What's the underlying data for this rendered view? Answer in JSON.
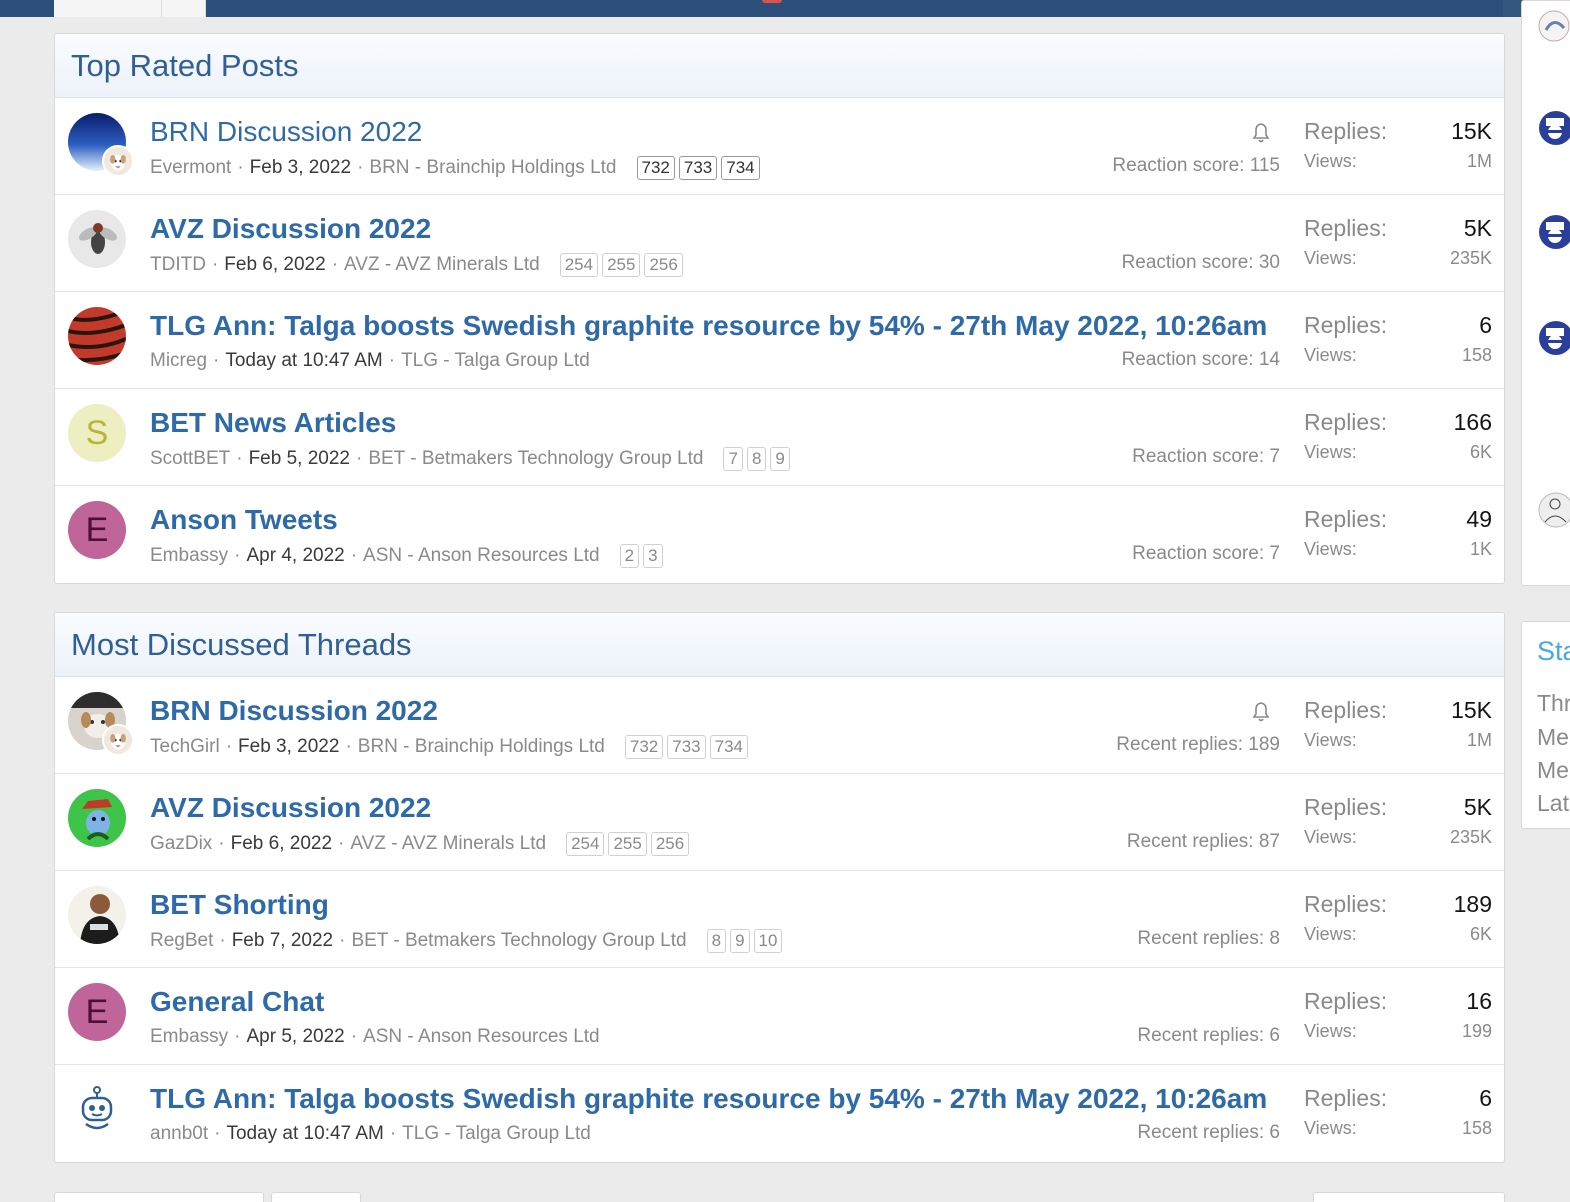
{
  "top_rated": {
    "title": "Top Rated Posts",
    "rows": [
      {
        "title": "BRN Discussion 2022",
        "bold": false,
        "author": "Evermont",
        "date": "Feb 3, 2022",
        "forum": "BRN - Brainchip Holdings Ltd",
        "pages": [
          "732",
          "733",
          "734"
        ],
        "pages_dark": true,
        "bell": true,
        "score": "Reaction score: 115",
        "replies_label": "Replies:",
        "replies": "15K",
        "views_label": "Views:",
        "views": "1M",
        "avatar": "blue-gradient-avatar",
        "avatar_letter": ""
      },
      {
        "title": "AVZ Discussion 2022",
        "bold": true,
        "author": "TDITD",
        "date": "Feb 6, 2022",
        "forum": "AVZ - AVZ Minerals Ltd",
        "pages": [
          "254",
          "255",
          "256"
        ],
        "pages_dark": false,
        "bell": false,
        "score": "Reaction score: 30",
        "replies_label": "Replies:",
        "replies": "5K",
        "views_label": "Views:",
        "views": "235K",
        "avatar": "fly-avatar",
        "avatar_letter": ""
      },
      {
        "title": "TLG Ann: Talga boosts Swedish graphite resource by 54% - 27th May 2022, 10:26am",
        "bold": true,
        "author": "Micreg",
        "date": "Today at 10:47 AM",
        "forum": "TLG - Talga Group Ltd",
        "pages": [],
        "pages_dark": false,
        "bell": false,
        "score": "Reaction score: 14",
        "replies_label": "Replies:",
        "replies": "6",
        "views_label": "Views:",
        "views": "158",
        "avatar": "tiger-stripe-avatar",
        "avatar_letter": ""
      },
      {
        "title": "BET News Articles",
        "bold": true,
        "author": "ScottBET",
        "date": "Feb 5, 2022",
        "forum": "BET - Betmakers Technology Group Ltd",
        "pages": [
          "7",
          "8",
          "9"
        ],
        "pages_dark": false,
        "bell": false,
        "score": "Reaction score: 7",
        "replies_label": "Replies:",
        "replies": "166",
        "views_label": "Views:",
        "views": "6K",
        "avatar": "letter-avatar",
        "avatar_letter": "S"
      },
      {
        "title": "Anson Tweets",
        "bold": true,
        "author": "Embassy",
        "date": "Apr 4, 2022",
        "forum": "ASN - Anson Resources Ltd",
        "pages": [
          "2",
          "3"
        ],
        "pages_dark": false,
        "bell": false,
        "score": "Reaction score: 7",
        "replies_label": "Replies:",
        "replies": "49",
        "views_label": "Views:",
        "views": "1K",
        "avatar": "letter-avatar",
        "avatar_letter": "E"
      }
    ]
  },
  "most_discussed": {
    "title": "Most Discussed Threads",
    "rows": [
      {
        "title": "BRN Discussion 2022",
        "bold": true,
        "author": "TechGirl",
        "date": "Feb 3, 2022",
        "forum": "BRN - Brainchip Holdings Ltd",
        "pages": [
          "732",
          "733",
          "734"
        ],
        "pages_dark": false,
        "bell": true,
        "score": "Recent replies: 189",
        "replies_label": "Replies:",
        "replies": "15K",
        "views_label": "Views:",
        "views": "1M",
        "avatar": "dog-avatar",
        "avatar_letter": ""
      },
      {
        "title": "AVZ Discussion 2022",
        "bold": true,
        "author": "GazDix",
        "date": "Feb 6, 2022",
        "forum": "AVZ - AVZ Minerals Ltd",
        "pages": [
          "254",
          "255",
          "256"
        ],
        "pages_dark": false,
        "bell": false,
        "score": "Recent replies: 87",
        "replies_label": "Replies:",
        "replies": "5K",
        "views_label": "Views:",
        "views": "235K",
        "avatar": "cartoon-avatar",
        "avatar_letter": ""
      },
      {
        "title": "BET Shorting",
        "bold": true,
        "author": "RegBet",
        "date": "Feb 7, 2022",
        "forum": "BET - Betmakers Technology Group Ltd",
        "pages": [
          "8",
          "9",
          "10"
        ],
        "pages_dark": false,
        "bell": false,
        "score": "Recent replies: 8",
        "replies_label": "Replies:",
        "replies": "189",
        "views_label": "Views:",
        "views": "6K",
        "avatar": "person-avatar",
        "avatar_letter": ""
      },
      {
        "title": "General Chat",
        "bold": true,
        "author": "Embassy",
        "date": "Apr 5, 2022",
        "forum": "ASN - Anson Resources Ltd",
        "pages": [],
        "pages_dark": false,
        "bell": false,
        "score": "Recent replies: 6",
        "replies_label": "Replies:",
        "replies": "16",
        "views_label": "Views:",
        "views": "199",
        "avatar": "letter-avatar",
        "avatar_letter": "E"
      },
      {
        "title": "TLG Ann: Talga boosts Swedish graphite resource by 54% - 27th May 2022, 10:26am",
        "bold": true,
        "author": "annb0t",
        "date": "Today at 10:47 AM",
        "forum": "TLG - Talga Group Ltd",
        "pages": [],
        "pages_dark": false,
        "bell": false,
        "score": "Recent replies: 6",
        "replies_label": "Replies:",
        "replies": "6",
        "views_label": "Views:",
        "views": "158",
        "avatar": "robot-avatar",
        "avatar_letter": ""
      }
    ]
  },
  "sidebar_stats": {
    "title": "Sta",
    "lines": [
      "Thr",
      "Me",
      "Me",
      "Lat"
    ]
  },
  "colors": {
    "link": "#2f6aa8",
    "header_text": "#2f5f93",
    "topbar": "#2c5079",
    "muted": "#8a8a8a"
  }
}
